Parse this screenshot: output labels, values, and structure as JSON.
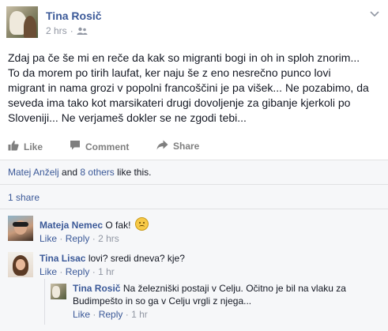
{
  "post": {
    "author": "Tina Rosič",
    "time": "2 hrs",
    "separator": "·",
    "text": "Zdaj pa če še mi en reče da kak so migranti bogi in oh in sploh znorim...\nTo da morem po tirih laufat, ker naju še z eno nesrečno punco lovi\nmigrant in nama grozi v popolni francoščini je pa višek... Ne pozabimo, da\nseveda ima tako kot marsikateri drugi dovoljenje za gibanje kjerkoli po\nSloveniji... Ne verjameš dokler se ne zgodi tebi..."
  },
  "actions": {
    "like": "Like",
    "comment": "Comment",
    "share": "Share"
  },
  "likes": {
    "first_name": "Matej Anželj",
    "and": "and",
    "others": "8 others",
    "suffix": "like this."
  },
  "shares": {
    "count_text": "1 share"
  },
  "comments": [
    {
      "author": "Mateja Nemec",
      "text": "O fak!",
      "emoji": "disappointed-face",
      "like": "Like",
      "reply": "Reply",
      "time": "2 hrs",
      "sep": "·"
    },
    {
      "author": "Tina Lisac",
      "text": "lovi? sredi dneva? kje?",
      "like": "Like",
      "reply": "Reply",
      "time": "1 hr",
      "sep": "·",
      "replies": [
        {
          "author": "Tina Rosič",
          "text": "Na železniški postaji v Celju. Očitno je bil na vlaku za",
          "text2": "Budimpešto in so ga v Celju vrgli z njega...",
          "like": "Like",
          "reply": "Reply",
          "time": "1 hr",
          "sep": "·"
        }
      ]
    }
  ],
  "colors": {
    "link": "#3b5998",
    "meta": "#9197a3",
    "ufi_bg": "#f6f7f9"
  }
}
